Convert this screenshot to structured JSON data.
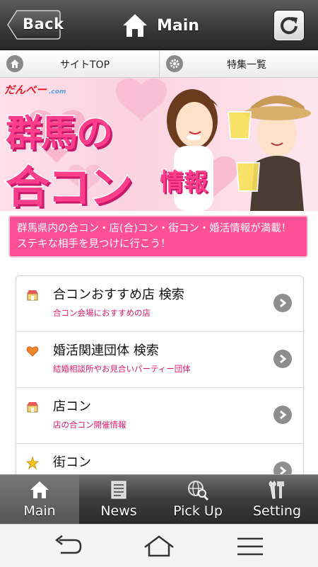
{
  "header": {
    "back_label": "Back",
    "title": "Main",
    "refresh_icon": "refresh-icon",
    "home_icon": "home-icon"
  },
  "subnav": {
    "items": [
      {
        "label": "サイトTOP",
        "icon": "home-icon"
      },
      {
        "label": "特集一覧",
        "icon": "gear-icon"
      }
    ]
  },
  "banner": {
    "logo": "だんべー",
    "logo_sub": ".com",
    "title_line1": "群馬の",
    "title_line2": "合コン",
    "title_line3": "情報"
  },
  "intro_text": "群馬県内の合コン・店(合)コン・街コン・婚活情報が満載！ステキな相手を見つけに行こう！",
  "list": {
    "items": [
      {
        "title": "合コンおすすめ店 検索",
        "subtitle": "合コン会場におすすめの店",
        "icon": "shop-icon"
      },
      {
        "title": "婚活関連団体 検索",
        "subtitle": "結婚相談所やお見合いパーティー団体",
        "icon": "heart-icon"
      },
      {
        "title": "店コン",
        "subtitle": "店の合コン開催情報",
        "icon": "shop-icon"
      },
      {
        "title": "街コン",
        "subtitle": "",
        "icon": "star-icon"
      }
    ]
  },
  "tabbar": {
    "tabs": [
      {
        "label": "Main",
        "icon": "home-icon",
        "active": true
      },
      {
        "label": "News",
        "icon": "news-icon",
        "active": false
      },
      {
        "label": "Pick Up",
        "icon": "globe-search-icon",
        "active": false
      },
      {
        "label": "Setting",
        "icon": "tools-icon",
        "active": false
      }
    ]
  },
  "colors": {
    "accent_pink": "#ff4f96",
    "subtitle_pink": "#e0186c",
    "header_dark": "#3a3a3a"
  }
}
